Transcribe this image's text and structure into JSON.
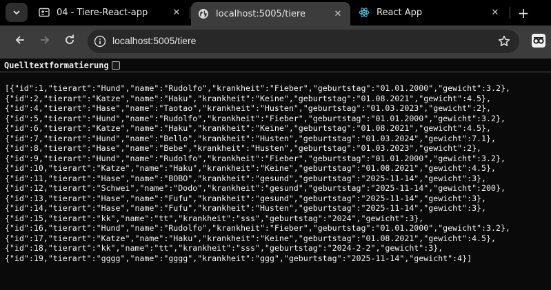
{
  "tabs": [
    {
      "title": "04 - Tiere-React-app",
      "icon": "profile-icon",
      "active": false
    },
    {
      "title": "localhost:5005/tiere",
      "icon": "globe-icon",
      "active": true
    },
    {
      "title": "React App",
      "icon": "react-icon",
      "active": false
    }
  ],
  "toolbar": {
    "url": "localhost:5005/tiere"
  },
  "content": {
    "pretty_print_label": "Quelltextformatierung",
    "pretty_print_checked": false,
    "json_lines": [
      "[{\"id\":1,\"tierart\":\"Hund\",\"name\":\"Rudolfo\",\"krankheit\":\"Fieber\",\"geburtstag\":\"01.01.2000\",\"gewicht\":3.2},",
      "{\"id\":2,\"tierart\":\"Katze\",\"name\":\"Haku\",\"krankheit\":\"Keine\",\"geburtstag\":\"01.08.2021\",\"gewicht\":4.5},",
      "{\"id\":4,\"tierart\":\"Hase\",\"name\":\"Taotao\",\"krankheit\":\"Husten\",\"geburtstag\":\"01.03.2023\",\"gewicht\":2},",
      "{\"id\":5,\"tierart\":\"Hund\",\"name\":\"Rudolfo\",\"krankheit\":\"Fieber\",\"geburtstag\":\"01.01.2000\",\"gewicht\":3.2},",
      "{\"id\":6,\"tierart\":\"Katze\",\"name\":\"Haku\",\"krankheit\":\"Keine\",\"geburtstag\":\"01.08.2021\",\"gewicht\":4.5},",
      "{\"id\":7,\"tierart\":\"Hund\",\"name\":\"Bello\",\"krankheit\":\"Husten\",\"geburtstag\":\"01.03.2024\",\"gewicht\":7.1},",
      "{\"id\":8,\"tierart\":\"Hase\",\"name\":\"Bebe\",\"krankheit\":\"Husten\",\"geburtstag\":\"01.03.2023\",\"gewicht\":2},",
      "{\"id\":9,\"tierart\":\"Hund\",\"name\":\"Rudolfo\",\"krankheit\":\"Fieber\",\"geburtstag\":\"01.01.2000\",\"gewicht\":3.2},",
      "{\"id\":10,\"tierart\":\"Katze\",\"name\":\"Haku\",\"krankheit\":\"Keine\",\"geburtstag\":\"01.08.2021\",\"gewicht\":4.5},",
      "{\"id\":11,\"tierart\":\"Hase\",\"name\":\"BOBO\",\"krankheit\":\"gesund\",\"geburtstag\":\"2025-11-14\",\"gewicht\":3},",
      "{\"id\":12,\"tierart\":\"Schwei\",\"name\":\"Dodo\",\"krankheit\":\"gesund\",\"geburtstag\":\"2025-11-14\",\"gewicht\":200},",
      "{\"id\":13,\"tierart\":\"Hase\",\"name\":\"Fufu\",\"krankheit\":\"gesund\",\"geburtstag\":\"2025-11-14\",\"gewicht\":3},",
      "{\"id\":14,\"tierart\":\"Hase\",\"name\":\"Fufu\",\"krankheit\":\"Husten\",\"geburtstag\":\"2025-11-14\",\"gewicht\":3},",
      "{\"id\":15,\"tierart\":\"kk\",\"name\":\"tt\",\"krankheit\":\"sss\",\"geburtstag\":\"2024\",\"gewicht\":3},",
      "{\"id\":16,\"tierart\":\"Hund\",\"name\":\"Rudolfo\",\"krankheit\":\"Fieber\",\"geburtstag\":\"01.01.2000\",\"gewicht\":3.2},",
      "{\"id\":17,\"tierart\":\"Katze\",\"name\":\"Haku\",\"krankheit\":\"Keine\",\"geburtstag\":\"01.08.2021\",\"gewicht\":4.5},",
      "{\"id\":18,\"tierart\":\"kk\",\"name\":\"tt\",\"krankheit\":\"sss\",\"geburtstag\":\"2024-2-2\",\"gewicht\":3},",
      "{\"id\":19,\"tierart\":\"gggg\",\"name\":\"gggg\",\"krankheit\":\"ggg\",\"geburtstag\":\"2025-11-14\",\"gewicht\":4}]"
    ]
  },
  "colors": {
    "tab_strip_bg": "#000000",
    "active_tab_bg": "#3c3c3c",
    "toolbar_bg": "#3c3c3c",
    "omnibox_bg": "#282828",
    "page_bg": "#0a0a0a",
    "text": "#f2f2f2"
  }
}
